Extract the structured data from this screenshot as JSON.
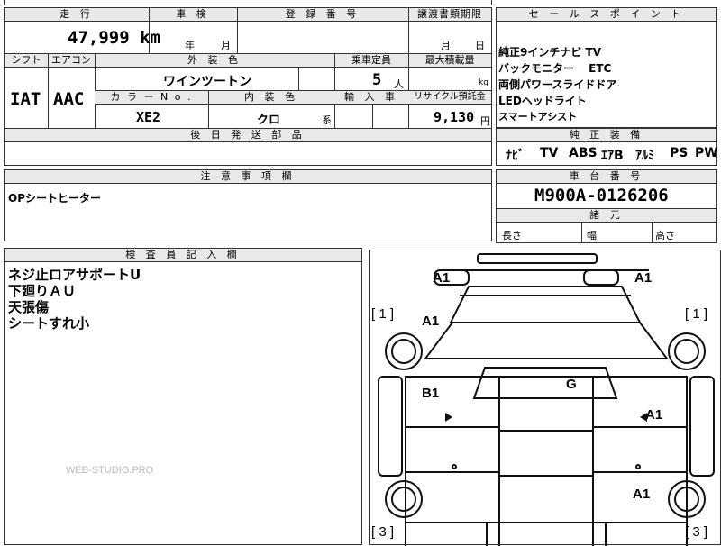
{
  "top": {
    "h_mileage": "走 行",
    "h_inspection": "車 検",
    "h_registration": "登 録 番 号",
    "h_transfer": "譲渡書類期限",
    "mileage": "47,999 km",
    "insp_year": "年",
    "insp_month": "月",
    "transfer_month": "月",
    "transfer_day": "日",
    "h_shift": "シフト",
    "h_ac": "エアコン",
    "h_exterior": "外 装 色",
    "h_capacity": "乗車定員",
    "h_load": "最大積載量",
    "shift": "IAT",
    "ac": "AAC",
    "exterior_color": "ワインツートン",
    "capacity": "5",
    "capacity_unit": "人",
    "load_unit": "kg",
    "h_color_no": "カ ラ ー N o .",
    "h_interior": "内 装 色",
    "h_import": "輸 入 車",
    "h_recycle": "リサイクル預託金",
    "color_no": "XE2",
    "interior_color": "クロ",
    "interior_suffix": "系",
    "recycle_fee": "9,130",
    "recycle_unit": "円",
    "h_parts": "後 日 発 送 部 品"
  },
  "sales": {
    "header": "セ ー ル ス ポ イ ン ト",
    "lines": [
      "純正9インチナビ TV",
      "バックモニター　 ETC",
      "両側パワースライドドア",
      "LEDヘッドライト",
      "スマートアシスト"
    ]
  },
  "equipment": {
    "header": "純 正 装 備",
    "items": [
      "ﾅﾋﾞ",
      "TV",
      "ABS",
      "ｴｱB",
      "ｱﾙﾐ",
      "PS",
      "PW"
    ]
  },
  "notes": {
    "header": "注 意 事 項 欄",
    "text": "OPシートヒーター"
  },
  "chassis": {
    "header": "車 台 番 号",
    "number": "M900A-0126206",
    "dim_header": "諸 元",
    "length": "長さ",
    "width": "幅",
    "height": "高さ"
  },
  "inspector": {
    "header": "検 査 員 記 入 欄",
    "lines": [
      "ネジ止ロアサポートU",
      "下廻りＡＵ",
      "天張傷",
      "シートすれ小"
    ]
  },
  "diagram": {
    "marks": [
      "A1",
      "A1",
      "A1",
      "B1",
      "G",
      "A1",
      "A1"
    ],
    "brackets": [
      "[ 1 ]",
      "[ 1 ]",
      "[ 3 ]",
      "[ 3 ]"
    ]
  },
  "watermark": "WEB-STUDIO.PRO"
}
